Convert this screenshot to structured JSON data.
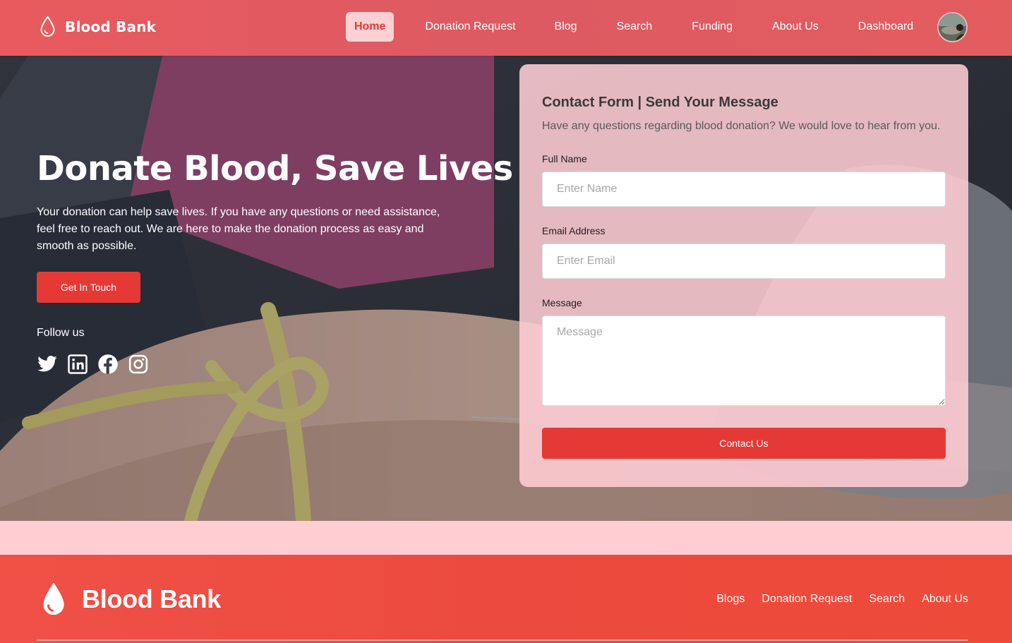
{
  "nav": {
    "brand": "Blood Bank",
    "links": [
      "Home",
      "Donation Request",
      "Blog",
      "Search",
      "Funding",
      "About Us",
      "Dashboard"
    ],
    "active_index": 0
  },
  "hero": {
    "title": "Donate Blood, Save Lives",
    "text": "Your donation can help save lives. If you have any questions or need assistance, feel free to reach out. We are here to make the donation process as easy and smooth as possible.",
    "cta_label": "Get In Touch",
    "follow_label": "Follow us",
    "social_icons": [
      "twitter-icon",
      "linkedin-icon",
      "facebook-icon",
      "instagram-icon"
    ]
  },
  "contact": {
    "title": "Contact Form | Send Your Message",
    "subtitle": "Have any questions regarding blood donation? We would love to hear from you.",
    "name_label": "Full Name",
    "name_placeholder": "Enter Name",
    "email_label": "Email Address",
    "email_placeholder": "Enter Email",
    "message_label": "Message",
    "message_placeholder": "Message",
    "submit_label": "Contact Us"
  },
  "footer": {
    "brand": "Blood Bank",
    "links": [
      "Blogs",
      "Donation Request",
      "Search",
      "About Us"
    ]
  },
  "colors": {
    "primary": "#e53935",
    "nav_bg": "#e05a60",
    "active_pill": "#ffd0d3",
    "card_bg": "#ffcdd4",
    "page_bg": "#ffcdd2",
    "footer_bg": "#ef4b3f"
  }
}
